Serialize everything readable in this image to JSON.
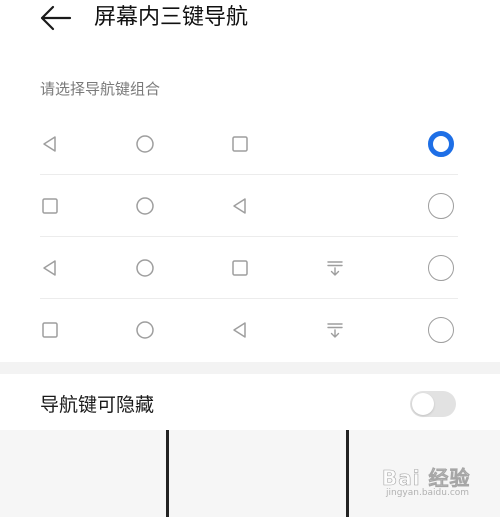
{
  "header": {
    "back_icon": "arrow-left-icon",
    "title": "屏幕内三键导航"
  },
  "section": {
    "subheading": "请选择导航键组合"
  },
  "options": [
    {
      "buttons": [
        "back-triangle",
        "home-circle",
        "recents-square"
      ],
      "selected": true
    },
    {
      "buttons": [
        "recents-square",
        "home-circle",
        "back-triangle"
      ],
      "selected": false
    },
    {
      "buttons": [
        "back-triangle",
        "home-circle",
        "recents-square",
        "hide-arrow"
      ],
      "selected": false
    },
    {
      "buttons": [
        "recents-square",
        "home-circle",
        "back-triangle",
        "hide-arrow"
      ],
      "selected": false
    }
  ],
  "hide_toggle": {
    "label": "导航键可隐藏",
    "enabled": false
  },
  "watermark": {
    "main": "Bai 经验",
    "sub": "jingyan.baidu.com"
  },
  "colors": {
    "accent": "#1e6fe6",
    "icon_gray": "#9e9e9e",
    "divider": "#ececec",
    "toggle_off": "#e2e2e2"
  }
}
